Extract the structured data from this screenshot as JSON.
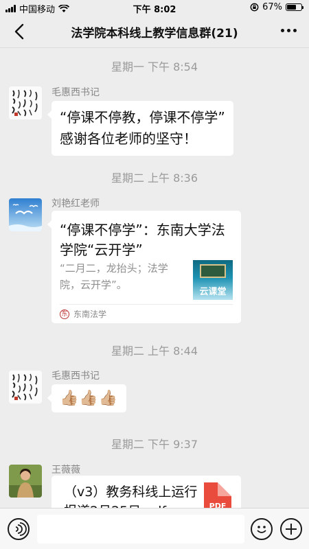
{
  "status_bar": {
    "carrier": "中国移动",
    "time": "下午 8:02",
    "battery": "67%",
    "battery_level": 0.67
  },
  "header": {
    "title": "法学院本科线上教学信息群(21)"
  },
  "messages": [
    {
      "timestamp": "星期一 下午 8:54",
      "sender": "毛惠西书记",
      "lines": [
        "“停课不停教，停课不停学”",
        "感谢各位老师的坚守！"
      ]
    },
    {
      "timestamp": "星期二 上午 8:36",
      "sender": "刘艳红老师",
      "card": {
        "title": "“停课不停学”：东南大学法学院“云开学”",
        "description": "“二月二，龙抬头；法学院，云开学”。",
        "thumbnail_text": "云课堂",
        "source": "东南法学",
        "source_logo": "东"
      }
    },
    {
      "timestamp": "星期二 上午 8:44",
      "sender": "毛惠西书记",
      "emoji": "👍🏼👍🏼👍🏼"
    },
    {
      "timestamp": "星期二 下午 9:37",
      "sender": "王薇薇",
      "file": {
        "name": "（v3）教务科线上运行报道2月25日.pdf",
        "icon_text": "PDF"
      }
    }
  ],
  "input_bar": {
    "icons": [
      "voice-icon",
      "emoji-icon",
      "plus-icon"
    ]
  }
}
